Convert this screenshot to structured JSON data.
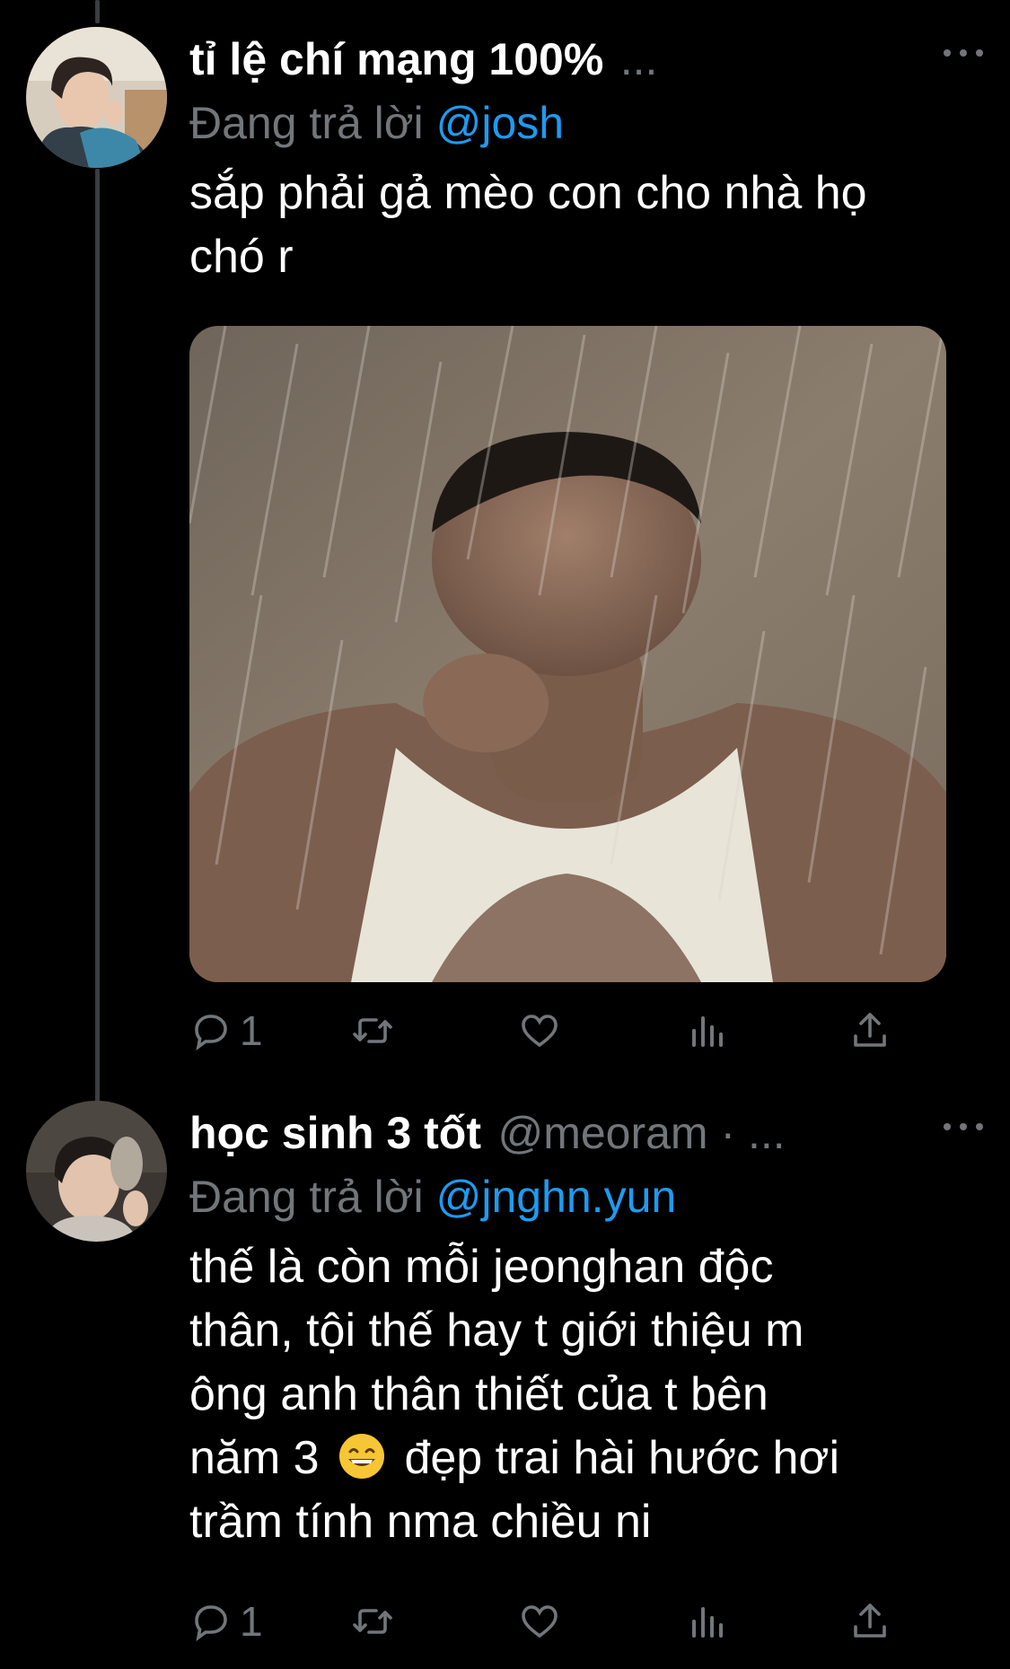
{
  "tweets": [
    {
      "display_name": "tỉ lệ chí mạng 100%",
      "handle": "...",
      "replying_prefix": "Đang trả lời",
      "replying_to": "@josh",
      "text_lines": [
        "sắp phải gả mèo con cho nhà họ",
        "chó r"
      ],
      "actions": {
        "reply_count": "1"
      }
    },
    {
      "display_name": "học sinh 3 tốt",
      "handle": "@meoram · ...",
      "replying_prefix": "Đang trả lời",
      "replying_to": "@jnghn.yun",
      "text_lines": [
        "thế là còn mỗi jeonghan độc",
        "thân, tội thế hay t giới thiệu m",
        "ông anh thân thiết của t bên",
        "năm 3",
        "đẹp trai hài hước hơi",
        "trầm tính nma chiều ni"
      ],
      "emoji": "grinning-face-with-smiling-eyes",
      "actions": {
        "reply_count": "1"
      }
    }
  ],
  "colors": {
    "background": "#000000",
    "text_primary": "#ffffff",
    "text_secondary": "#71767b",
    "accent": "#1d9bf0",
    "thread_line": "#3a3d41"
  },
  "icons": {
    "reply": "comment-bubble-icon",
    "retweet": "retweet-icon",
    "like": "heart-icon",
    "views": "analytics-bars-icon",
    "share": "share-upload-icon",
    "more": "more-dots-icon"
  }
}
